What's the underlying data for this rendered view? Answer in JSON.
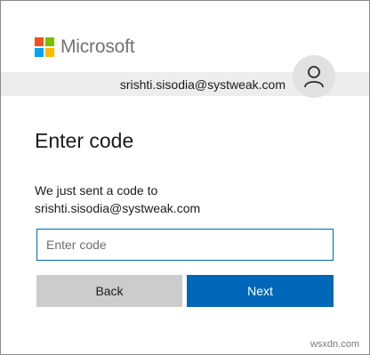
{
  "brand": {
    "name": "Microsoft"
  },
  "identity": {
    "email": "srishti.sisodia@systweak.com",
    "avatar_icon": "person-icon"
  },
  "page": {
    "title": "Enter code",
    "description_line1": "We just sent a code to",
    "description_line2": "srishti.sisodia@systweak.com"
  },
  "code_input": {
    "placeholder": "Enter code",
    "value": ""
  },
  "buttons": {
    "back_label": "Back",
    "next_label": "Next"
  },
  "watermark": "wsxdn.com",
  "colors": {
    "accent": "#0067b8",
    "logo_red": "#f25022",
    "logo_green": "#7fba00",
    "logo_blue": "#00a4ef",
    "logo_yellow": "#ffb900"
  }
}
